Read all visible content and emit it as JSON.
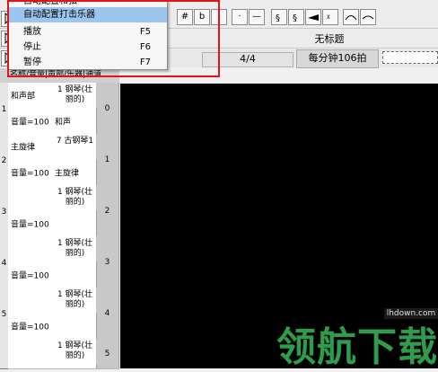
{
  "toolbar": {
    "sharp": "#",
    "flat": "b",
    "natural": "♮",
    "dot": "·",
    "dash": "—"
  },
  "document": {
    "title": "无标题"
  },
  "status": {
    "time_signature": "4/4",
    "tempo": "每分钟106拍"
  },
  "menu": {
    "items": [
      {
        "label": "自动配置和弦",
        "shortcut": ""
      },
      {
        "label": "自动配置打击乐器",
        "shortcut": "",
        "selected": true
      },
      {
        "label": "播放",
        "shortcut": "F5"
      },
      {
        "label": "停止",
        "shortcut": "F6"
      },
      {
        "label": "暂停",
        "shortcut": "F7"
      }
    ]
  },
  "tracks": {
    "header": "名称/音量|声部/乐器|通道",
    "rows": [
      {
        "index": "1",
        "name": "和声部",
        "instrument": "1 钢琴(壮丽的)",
        "channel": "0",
        "volume": "音量=100",
        "part": "和声"
      },
      {
        "index": "2",
        "name": "主旋律",
        "instrument": "7 古钢琴1",
        "channel": "1",
        "volume": "音量=100",
        "part": "主旋律"
      },
      {
        "index": "3",
        "name": "",
        "instrument": "1 钢琴(壮丽的)",
        "channel": "2",
        "volume": "音量=100",
        "part": ""
      },
      {
        "index": "4",
        "name": "",
        "instrument": "1 钢琴(壮丽的)",
        "channel": "3",
        "volume": "音量=100",
        "part": ""
      },
      {
        "index": "5",
        "name": "",
        "instrument": "1 钢琴(壮丽的)",
        "channel": "4",
        "volume": "音量=100",
        "part": ""
      },
      {
        "index": "",
        "name": "",
        "instrument": "1 钢琴(壮丽的)",
        "channel": "5",
        "volume": "",
        "part": ""
      }
    ]
  },
  "watermark": {
    "text": "领航下载",
    "url": "lhdown.com"
  }
}
